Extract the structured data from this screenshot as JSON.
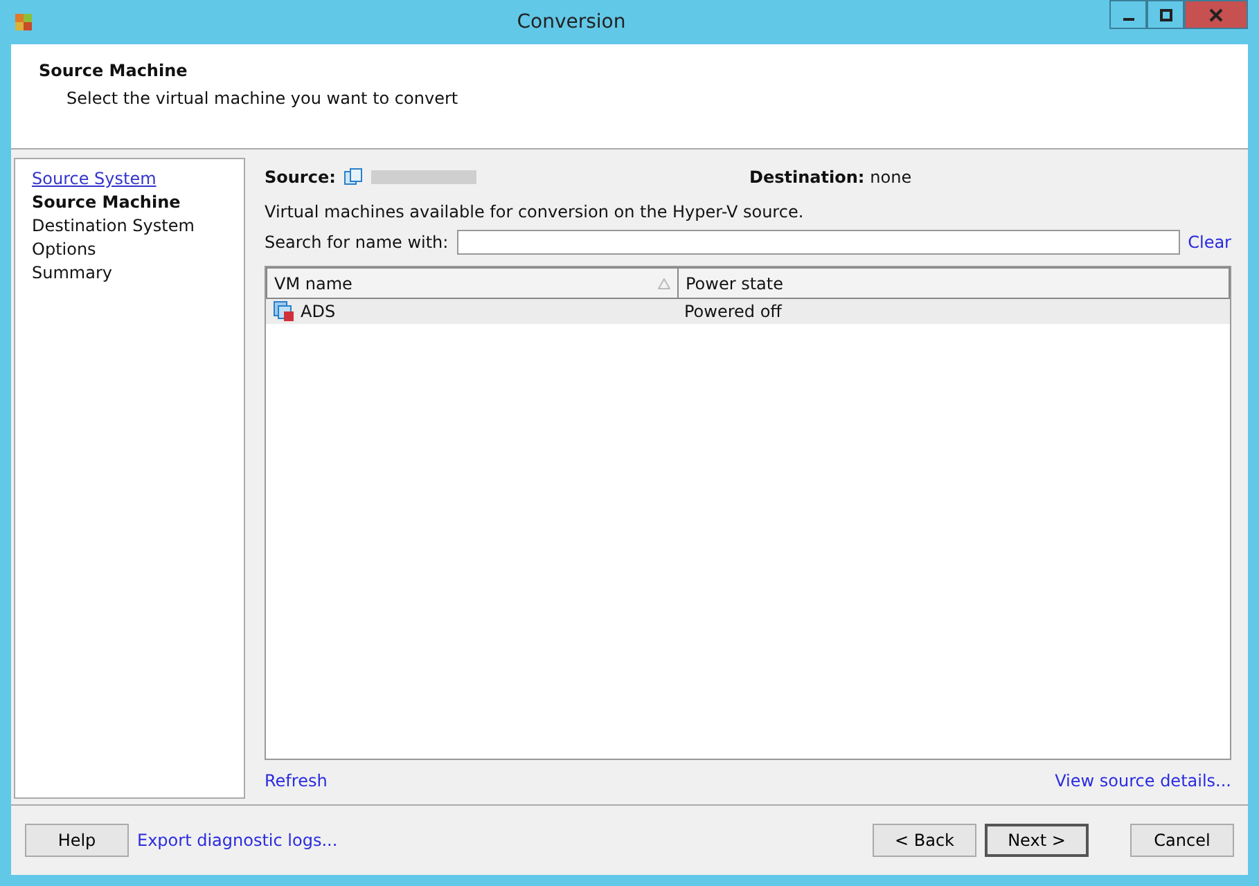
{
  "window": {
    "title": "Conversion"
  },
  "header": {
    "title": "Source Machine",
    "subtitle": "Select the virtual machine you want to convert"
  },
  "steps": [
    {
      "label": "Source System",
      "selected": false,
      "visited": true
    },
    {
      "label": "Source Machine",
      "selected": true,
      "visited": false
    },
    {
      "label": "Destination System",
      "selected": false,
      "visited": false
    },
    {
      "label": "Options",
      "selected": false,
      "visited": false
    },
    {
      "label": "Summary",
      "selected": false,
      "visited": false
    }
  ],
  "source": {
    "label": "Source:"
  },
  "destination": {
    "label": "Destination:",
    "value": "none"
  },
  "description": "Virtual machines available for conversion on the Hyper-V source.",
  "search": {
    "label": "Search for name with:",
    "clear": "Clear"
  },
  "table": {
    "columns": [
      "VM name",
      "Power state"
    ],
    "rows": [
      {
        "name": "ADS",
        "state": "Powered off",
        "selected": true
      }
    ]
  },
  "links": {
    "refresh": "Refresh",
    "details": "View source details..."
  },
  "footer": {
    "help": "Help",
    "export": "Export diagnostic logs...",
    "back": "< Back",
    "next": "Next >",
    "cancel": "Cancel"
  }
}
